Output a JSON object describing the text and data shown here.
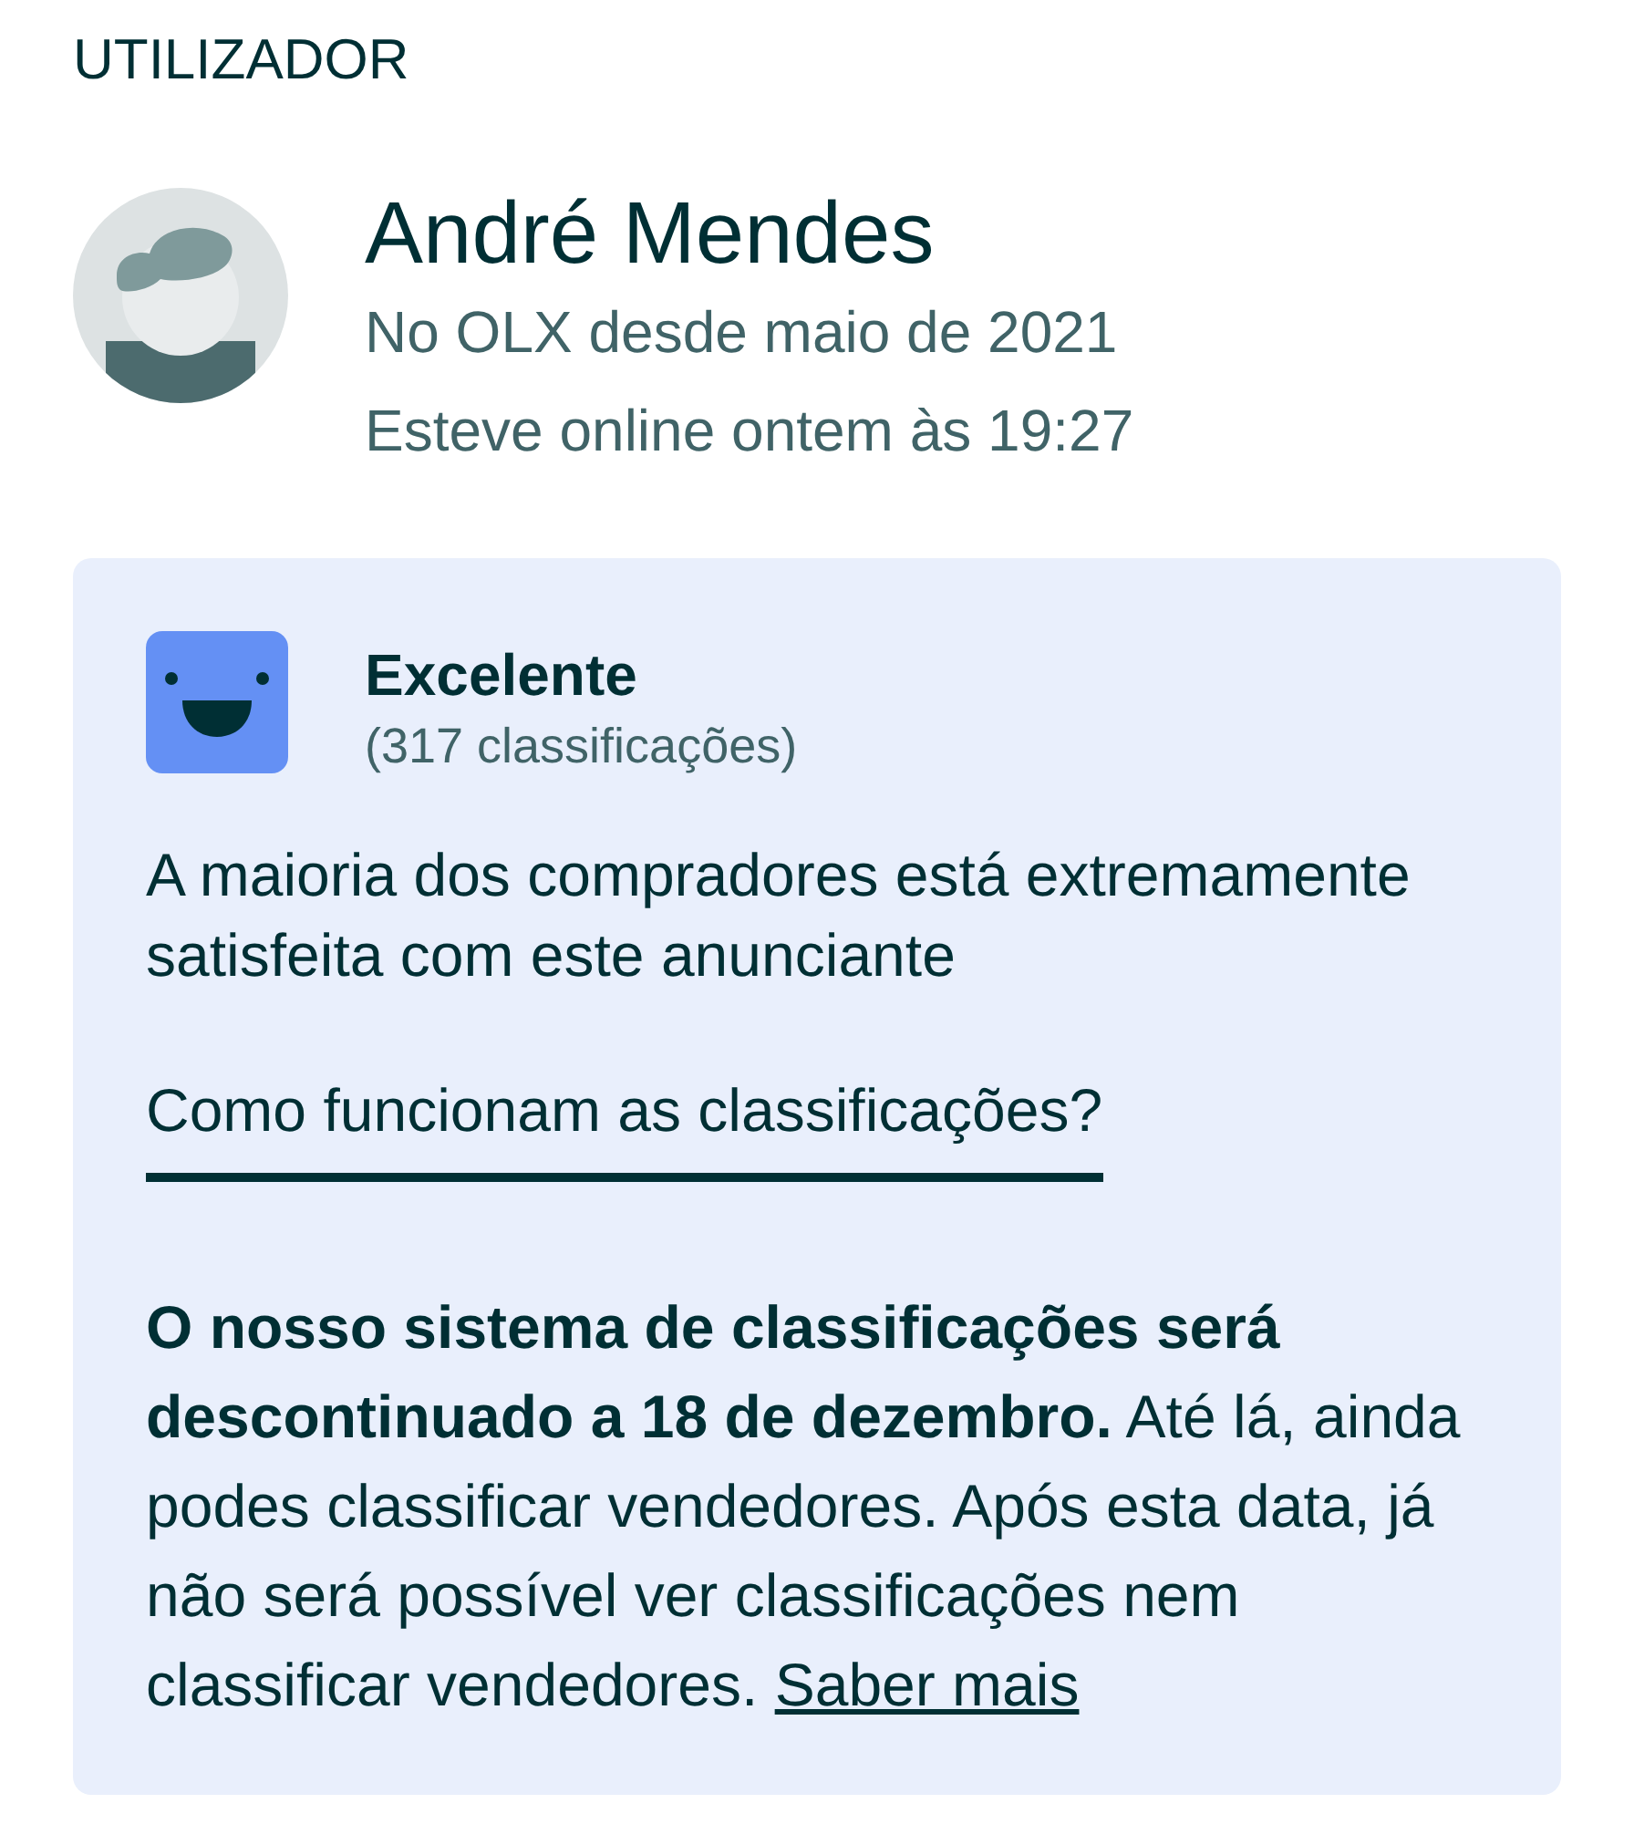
{
  "section_title": "UTILIZADOR",
  "user": {
    "name": "André Mendes",
    "member_since": "No OLX desde maio de 2021",
    "last_online": "Esteve online ontem às 19:27"
  },
  "rating": {
    "label": "Excelente",
    "count": "(317 classificações)",
    "summary": "A maioria dos compradores está extremamente satisfeita com este anunciante",
    "help_link": "Como funcionam as classificações?"
  },
  "notice": {
    "text": "**O nosso sistema de classificações será descontinuado a 18 de dezembro.** Até lá, ainda podes classificar vendedores. Após esta data, já não será possível ver classificações nem classificar vendedores.",
    "link": "Saber mais"
  }
}
